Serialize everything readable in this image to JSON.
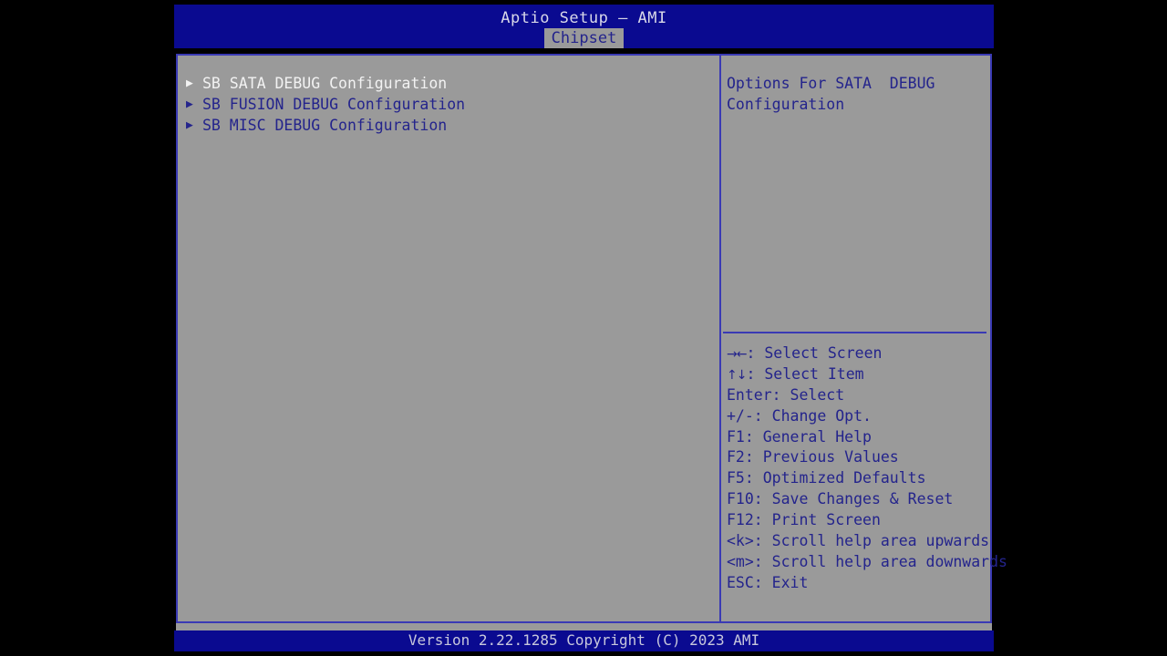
{
  "screen": {
    "title": "Aptio Setup – AMI",
    "active_tab": "Chipset",
    "footer": "Version 2.22.1285 Copyright (C) 2023 AMI",
    "colors": {
      "header_blue": "#0a0a90",
      "panel_gray": "#9a9a9a",
      "border_blue": "#3a3ab4",
      "text_blue": "#24248c",
      "selected_text": "#f2f2f2"
    }
  },
  "menu": {
    "items": [
      {
        "label": "SB SATA DEBUG Configuration",
        "arrow": "▶",
        "selected": true
      },
      {
        "label": "SB FUSION DEBUG Configuration",
        "arrow": "▶",
        "selected": false
      },
      {
        "label": "SB MISC DEBUG Configuration",
        "arrow": "▶",
        "selected": false
      }
    ]
  },
  "help": {
    "description": "Options For SATA  DEBUG Configuration",
    "keys": [
      {
        "glyph": "→←",
        "text": ": Select Screen"
      },
      {
        "glyph": "↑↓",
        "text": ": Select Item"
      },
      {
        "glyph": "",
        "text": "Enter: Select"
      },
      {
        "glyph": "",
        "text": "+/-: Change Opt."
      },
      {
        "glyph": "",
        "text": "F1: General Help"
      },
      {
        "glyph": "",
        "text": "F2: Previous Values"
      },
      {
        "glyph": "",
        "text": "F5: Optimized Defaults"
      },
      {
        "glyph": "",
        "text": "F10: Save Changes & Reset"
      },
      {
        "glyph": "",
        "text": "F12: Print Screen"
      },
      {
        "glyph": "",
        "text": "<k>: Scroll help area upwards"
      },
      {
        "glyph": "",
        "text": "<m>: Scroll help area downwards"
      },
      {
        "glyph": "",
        "text": "ESC: Exit"
      }
    ]
  }
}
